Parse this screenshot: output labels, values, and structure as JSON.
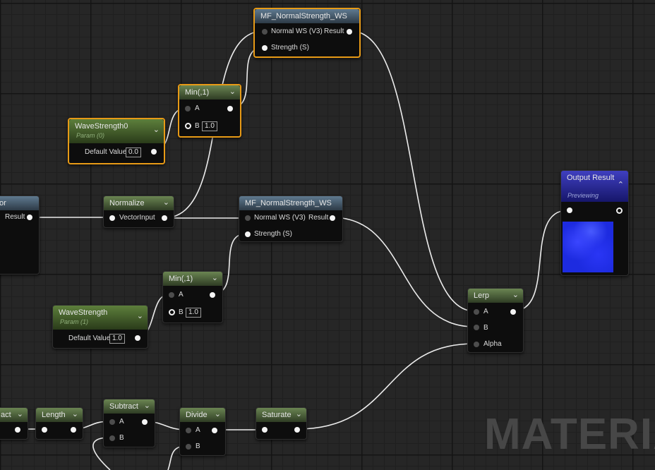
{
  "watermark": "MATERIAL",
  "nodes": {
    "mf_top": {
      "title": "MF_NormalStrength_WS",
      "in_a": "Normal WS (V3)",
      "in_b": "Strength (S)",
      "out": "Result"
    },
    "min_top": {
      "title": "Min(,1)",
      "in_a": "A",
      "in_b": "B",
      "b_value": "1.0"
    },
    "wavestrength0": {
      "title": "WaveStrength0",
      "subtitle": "Param (0)",
      "field_label": "Default Value",
      "field_value": "0.0"
    },
    "left_partial": {
      "title": "or",
      "out": "Result"
    },
    "normalize": {
      "title": "Normalize",
      "in": "VectorInput"
    },
    "mf_mid": {
      "title": "MF_NormalStrength_WS",
      "in_a": "Normal WS (V3)",
      "in_b": "Strength (S)",
      "out": "Result"
    },
    "output": {
      "title": "Output Result",
      "subtitle": "Previewing"
    },
    "min_mid": {
      "title": "Min(,1)",
      "in_a": "A",
      "in_b": "B",
      "b_value": "1.0"
    },
    "wavestrength": {
      "title": "WaveStrength",
      "subtitle": "Param (1)",
      "field_label": "Default Value",
      "field_value": "1.0"
    },
    "lerp": {
      "title": "Lerp",
      "in_a": "A",
      "in_b": "B",
      "in_c": "Alpha"
    },
    "subtract_partial": {
      "title": "act"
    },
    "length": {
      "title": "Length"
    },
    "subtract": {
      "title": "Subtract",
      "in_a": "A",
      "in_b": "B"
    },
    "divide": {
      "title": "Divide",
      "in_a": "A",
      "in_b": "B"
    },
    "saturate": {
      "title": "Saturate"
    }
  },
  "colors": {
    "selection": "#e79a16",
    "function_header": "#5f7a90",
    "expression_header": "#6a8552",
    "output_header": "#3f3fc0"
  },
  "icons": {
    "collapse": "chevron-down-icon",
    "expand": "chevron-up-icon"
  }
}
